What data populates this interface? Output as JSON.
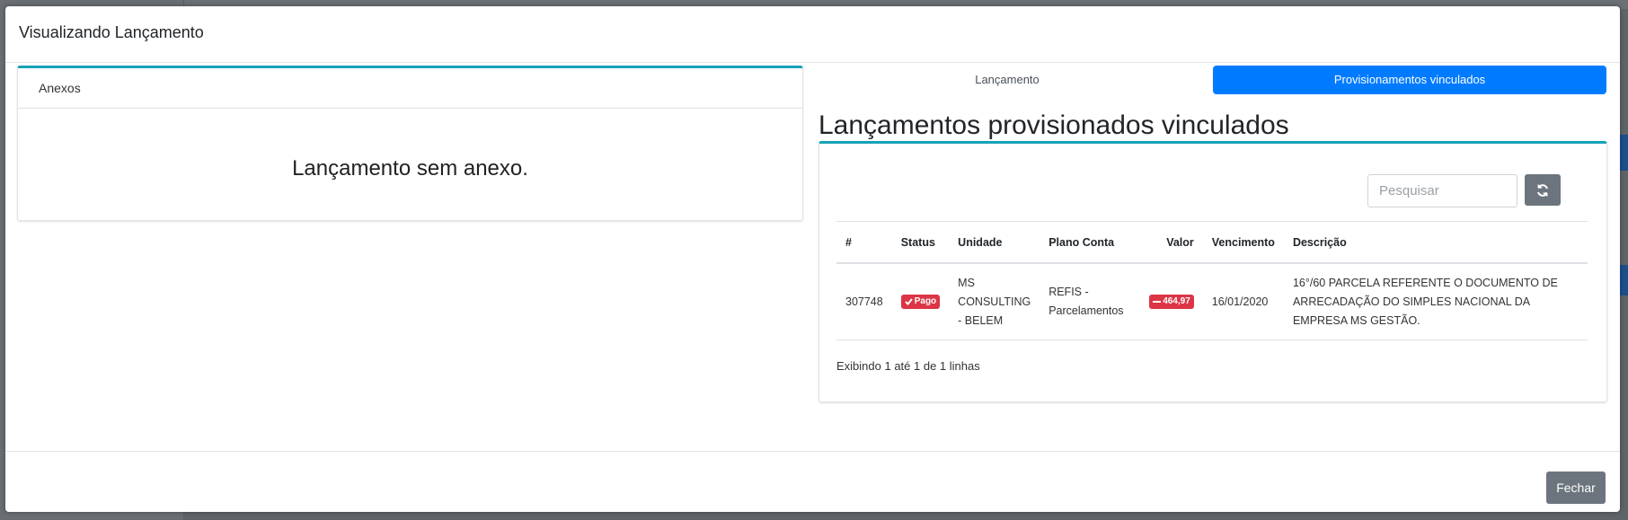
{
  "modal": {
    "title": "Visualizando Lançamento",
    "close_label": "Fechar"
  },
  "anexos": {
    "title": "Anexos",
    "empty_message": "Lançamento sem anexo."
  },
  "tabs": [
    {
      "label": "Lançamento",
      "active": false
    },
    {
      "label": "Provisionamentos vinculados",
      "active": true
    }
  ],
  "section_title": "Lançamentos provisionados vinculados",
  "search": {
    "placeholder": "Pesquisar"
  },
  "table": {
    "headers": [
      "#",
      "Status",
      "Unidade",
      "Plano Conta",
      "Valor",
      "Vencimento",
      "Descrição"
    ],
    "rows": [
      {
        "id": "307748",
        "status": "Pago",
        "unidade": "MS CONSULTING - BELEM",
        "plano_conta": "REFIS - Parcelamentos",
        "valor": "464,97",
        "vencimento": "16/01/2020",
        "descricao": "16°/60 PARCELA REFERENTE O DOCUMENTO DE ARRECADAÇÃO DO SIMPLES NACIONAL DA EMPRESA MS GESTÃO."
      }
    ],
    "footer": "Exibindo 1 até 1 de 1 linhas"
  },
  "colors": {
    "accent_teal": "#17a2b8",
    "primary": "#007bff",
    "danger": "#dc3545",
    "secondary": "#6c757d"
  }
}
